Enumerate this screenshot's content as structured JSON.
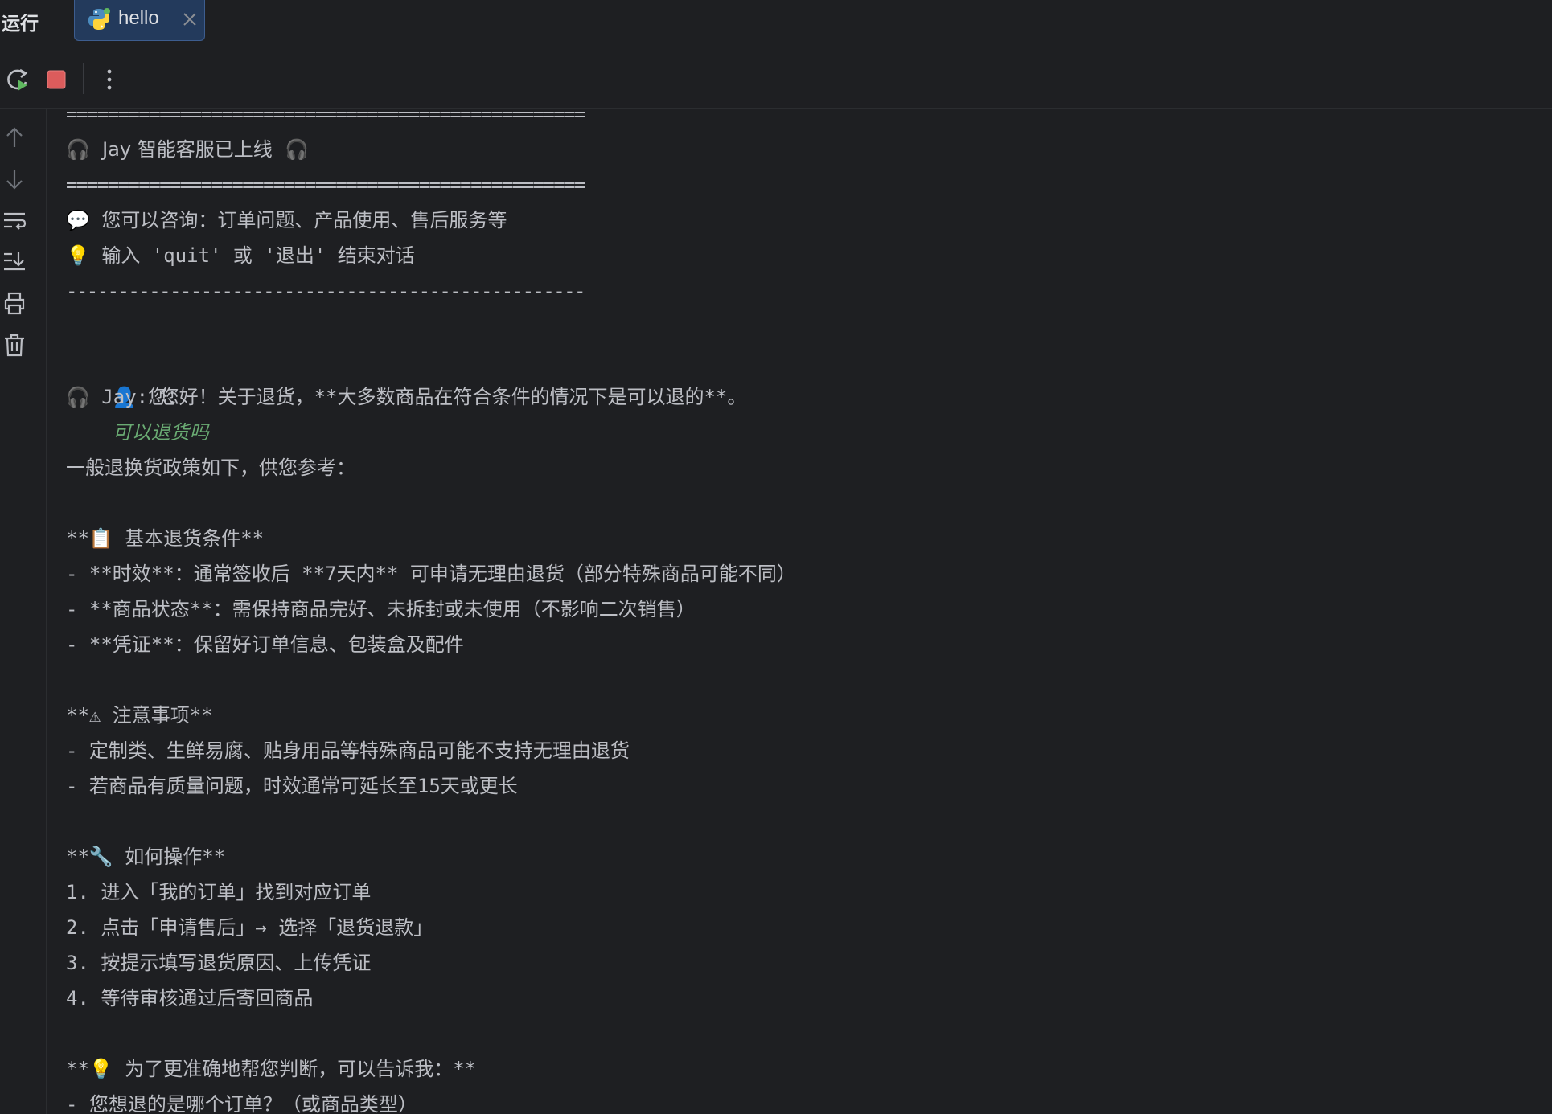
{
  "tool_window": {
    "title": "运行"
  },
  "tab": {
    "label": "hello"
  },
  "toolbar": {
    "rerun_icon": "rerun-icon",
    "stop_icon": "stop-icon",
    "more_icon": "more-vertical-icon"
  },
  "sidebar": {
    "icons": [
      "arrow-up-icon",
      "arrow-down-icon",
      "soft-wrap-icon",
      "scroll-to-end-icon",
      "print-icon",
      "trash-icon"
    ]
  },
  "colors": {
    "background": "#1e1f22",
    "text": "#bcbec4",
    "user_input": "#6aab73",
    "stop_red": "#db5c5c",
    "tab_bg": "#233a5c"
  },
  "console": {
    "lines": [
      "==================================================",
      "🎧  Jay 智能客服已上线  🎧",
      "==================================================",
      "💬 您可以咨询：订单问题、产品使用、售后服务等",
      "💡 输入 'quit' 或 '退出' 结束对话",
      "--------------------------------------------------",
      "",
      "👤 您：",
      "🎧 Jay: 您好！关于退货，**大多数商品在符合条件的情况下是可以退的**。",
      "",
      "一般退换货政策如下，供您参考：",
      "",
      "**📋 基本退货条件**",
      "- **时效**：通常签收后 **7天内** 可申请无理由退货（部分特殊商品可能不同）",
      "- **商品状态**：需保持商品完好、未拆封或未使用（不影响二次销售）",
      "- **凭证**：保留好订单信息、包装盒及配件",
      "",
      "**⚠ 注意事项**",
      "- 定制类、生鲜易腐、贴身用品等特殊商品可能不支持无理由退货",
      "- 若商品有质量问题，时效通常可延长至15天或更长",
      "",
      "**🔧 如何操作**",
      "1. 进入「我的订单」找到对应订单",
      "2. 点击「申请售后」→ 选择「退货退款」",
      "3. 按提示填写退货原因、上传凭证",
      "4. 等待审核通过后寄回商品",
      "",
      "**💡 为了更准确地帮您判断，可以告诉我：**",
      "- 您想退的是哪个订单？（或商品类型）"
    ],
    "user_input": "可以退货吗"
  }
}
